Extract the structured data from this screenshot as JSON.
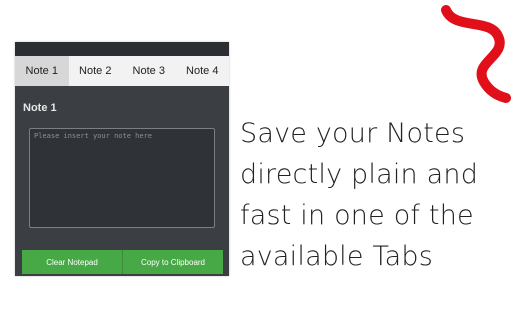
{
  "app": {
    "tabs": [
      {
        "label": "Note 1",
        "active": true
      },
      {
        "label": "Note 2",
        "active": false
      },
      {
        "label": "Note 3",
        "active": false
      },
      {
        "label": "Note 4",
        "active": false
      }
    ],
    "note_title": "Note 1",
    "note_placeholder": "Please insert your note here",
    "note_value": "",
    "buttons": {
      "clear": "Clear Notepad",
      "copy": "Copy to Clipboard"
    }
  },
  "promo": {
    "lines": [
      "Save your Notes",
      "directly plain and",
      "fast in one of the",
      "available Tabs"
    ]
  },
  "colors": {
    "accent_green": "#47a946",
    "panel_dark": "#3b3f43",
    "logo_red": "#e10f1a"
  },
  "icons": {
    "logo": "notepad-logo-icon"
  }
}
